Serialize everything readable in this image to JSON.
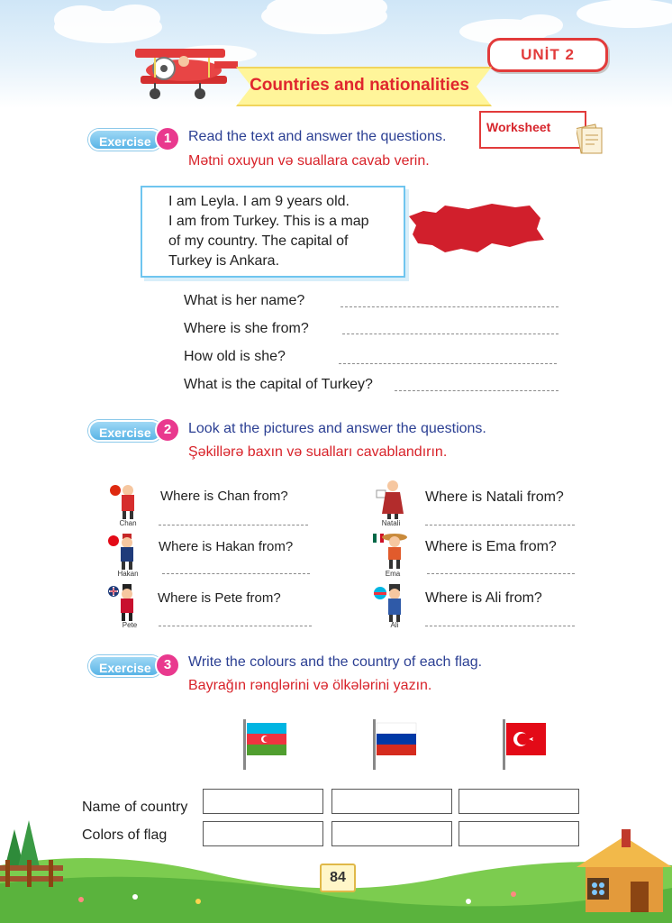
{
  "header": {
    "unit_label": "UNİT 2",
    "title": "Countries and nationalities",
    "worksheet_label": "Worksheet"
  },
  "exercise1": {
    "pill": "Exercise",
    "number": "1",
    "instruction_en": "Read the text and answer the questions.",
    "instruction_az": "Mətni oxuyun və suallara cavab verin.",
    "text_lines": [
      "I am Leyla. I am 9 years old.",
      "I am from Turkey. This is a map",
      "of my country. The capital of",
      "Turkey is Ankara."
    ],
    "questions": [
      "What is her name?",
      "Where is she from?",
      "How old is she?",
      "What is the capital of Turkey?"
    ]
  },
  "exercise2": {
    "pill": "Exercise",
    "number": "2",
    "instruction_en": "Look at the pictures and answer the questions.",
    "instruction_az": "Şəkillərə baxın və sualları cavablandırın.",
    "items": [
      {
        "name": "Chan",
        "question": "Where is Chan from?"
      },
      {
        "name": "Natali",
        "question": "Where is Natali from?"
      },
      {
        "name": "Hakan",
        "question": "Where is Hakan from?"
      },
      {
        "name": "Ema",
        "question": "Where is Ema from?"
      },
      {
        "name": "Pete",
        "question": "Where is Pete from?"
      },
      {
        "name": "Ali",
        "question": "Where is Ali from?"
      }
    ]
  },
  "exercise3": {
    "pill": "Exercise",
    "number": "3",
    "instruction_en": "Write the colours and the country of each flag.",
    "instruction_az": "Bayrağın rənglərini və ölkələrini yazın.",
    "row_labels": [
      "Name of country",
      "Colors of flag"
    ]
  },
  "footer": {
    "page_number": "84"
  },
  "colors": {
    "accent_red": "#e0272e",
    "accent_blue": "#2b3f93",
    "pill_blue": "#59b4e6",
    "number_pink": "#e9398e"
  }
}
